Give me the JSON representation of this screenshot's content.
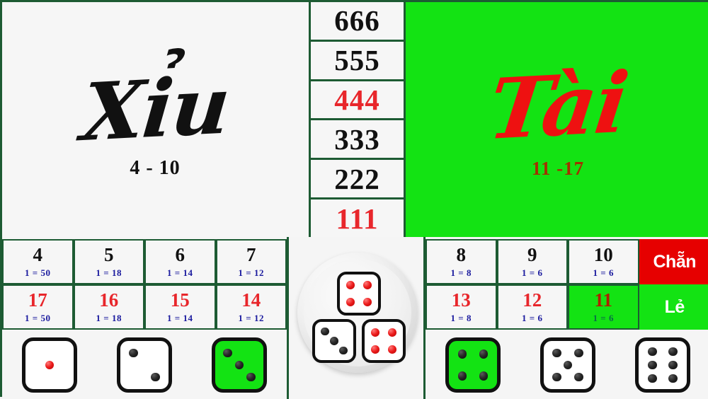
{
  "board": {
    "title": "Tai Xiu betting board",
    "colors": {
      "green": "#13e313",
      "red": "#e60000",
      "border_green": "#1d5b33",
      "odds_blue": "#1a1a9e",
      "big_red": "#e8262b"
    }
  },
  "left_panel": {
    "label": "Xỉu",
    "range": "4 - 10"
  },
  "right_panel": {
    "label": "Tài",
    "range": "11 -17"
  },
  "triples_column": [
    {
      "value": "666",
      "color": "black"
    },
    {
      "value": "555",
      "color": "black"
    },
    {
      "value": "444",
      "color": "red"
    },
    {
      "value": "333",
      "color": "black"
    },
    {
      "value": "222",
      "color": "black"
    },
    {
      "value": "111",
      "color": "red"
    }
  ],
  "bets_left": {
    "top_row": [
      {
        "number": "4",
        "odds": "1 = 50",
        "highlighted": false
      },
      {
        "number": "5",
        "odds": "1 = 18",
        "highlighted": false
      },
      {
        "number": "6",
        "odds": "1 = 14",
        "highlighted": false
      },
      {
        "number": "7",
        "odds": "1 = 12",
        "highlighted": false
      }
    ],
    "bottom_row": [
      {
        "number": "17",
        "odds": "1 = 50",
        "highlighted": false
      },
      {
        "number": "16",
        "odds": "1 = 18",
        "highlighted": false
      },
      {
        "number": "15",
        "odds": "1 = 14",
        "highlighted": false
      },
      {
        "number": "14",
        "odds": "1 = 12",
        "highlighted": false
      }
    ]
  },
  "bets_right": {
    "top_row": [
      {
        "number": "8",
        "odds": "1 = 8",
        "highlighted": false
      },
      {
        "number": "9",
        "odds": "1 = 6",
        "highlighted": false
      },
      {
        "number": "10",
        "odds": "1 = 6",
        "highlighted": false
      }
    ],
    "bottom_row": [
      {
        "number": "13",
        "odds": "1 = 8",
        "highlighted": false
      },
      {
        "number": "12",
        "odds": "1 = 6",
        "highlighted": false
      },
      {
        "number": "11",
        "odds": "1 = 6",
        "highlighted": true
      }
    ],
    "even_label": "Chẵn",
    "odd_label": "Lẻ"
  },
  "bowl": {
    "dice": [
      {
        "face": 4,
        "pip_color": "red",
        "position": "top"
      },
      {
        "face": 3,
        "pip_color": "black",
        "position": "bottom-left"
      },
      {
        "face": 4,
        "pip_color": "red",
        "position": "bottom-right"
      }
    ],
    "total": 11
  },
  "dice_legend_left": [
    {
      "face": 1,
      "pip_color": "red",
      "highlighted": false
    },
    {
      "face": 2,
      "pip_color": "black",
      "highlighted": false
    },
    {
      "face": 3,
      "pip_color": "black",
      "highlighted": true
    }
  ],
  "dice_legend_right": [
    {
      "face": 4,
      "pip_color": "black",
      "highlighted": true
    },
    {
      "face": 5,
      "pip_color": "black",
      "highlighted": false
    },
    {
      "face": 6,
      "pip_color": "black",
      "highlighted": false
    }
  ]
}
